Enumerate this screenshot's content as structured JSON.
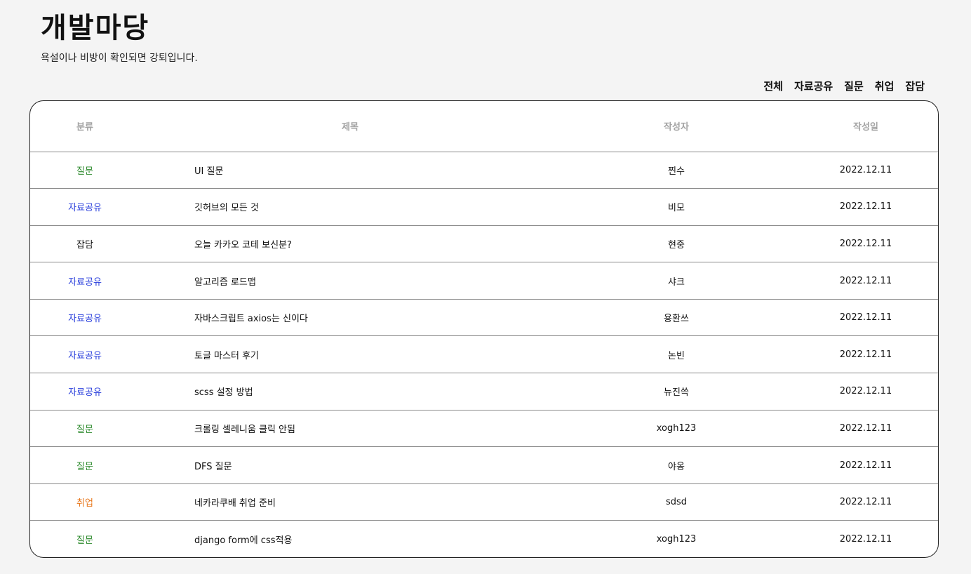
{
  "header": {
    "title": "개발마당",
    "subtitle": "욕설이나 비방이 확인되면 강퇴입니다."
  },
  "nav": {
    "items": [
      "전체",
      "자료공유",
      "질문",
      "취업",
      "잡담"
    ]
  },
  "colors": {
    "질문": "#2e8b2e",
    "자료공유": "#2a3fdc",
    "잡담": "#111111",
    "취업": "#e8761a"
  },
  "table": {
    "columns": [
      "분류",
      "제목",
      "작성자",
      "작성일"
    ],
    "rows": [
      {
        "category": "질문",
        "title": "UI 질문",
        "author": "찐수",
        "date": "2022.12.11"
      },
      {
        "category": "자료공유",
        "title": "깃허브의 모든 것",
        "author": "비모",
        "date": "2022.12.11"
      },
      {
        "category": "잡담",
        "title": "오늘 카카오 코테 보신분?",
        "author": "현중",
        "date": "2022.12.11"
      },
      {
        "category": "자료공유",
        "title": "알고리즘 로드맵",
        "author": "샤크",
        "date": "2022.12.11"
      },
      {
        "category": "자료공유",
        "title": "자바스크립트 axios는 신이다",
        "author": "용환쓰",
        "date": "2022.12.11"
      },
      {
        "category": "자료공유",
        "title": "토글 마스터 후기",
        "author": "논빈",
        "date": "2022.12.11"
      },
      {
        "category": "자료공유",
        "title": "scss 설정 방법",
        "author": "뉴진쓱",
        "date": "2022.12.11"
      },
      {
        "category": "질문",
        "title": "크롤링 셀레니움 클릭 안됨",
        "author": "xogh123",
        "date": "2022.12.11"
      },
      {
        "category": "질문",
        "title": "DFS 질문",
        "author": "야옹",
        "date": "2022.12.11"
      },
      {
        "category": "취업",
        "title": "네카라쿠배 취업 준비",
        "author": "sdsd",
        "date": "2022.12.11"
      },
      {
        "category": "질문",
        "title": "django form에 css적용",
        "author": "xogh123",
        "date": "2022.12.11"
      }
    ]
  }
}
